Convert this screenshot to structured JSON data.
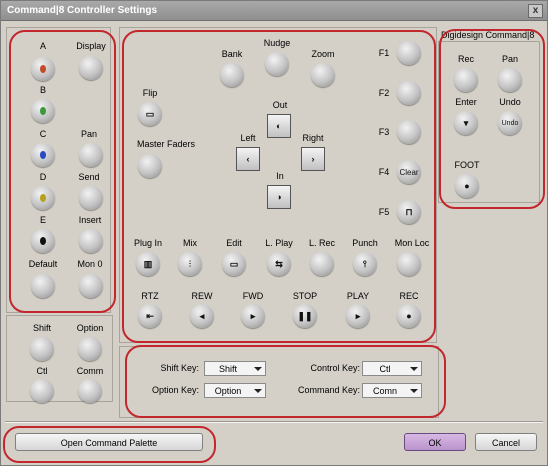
{
  "window": {
    "title": "Command|8 Controller Settings",
    "close_label": "x"
  },
  "left_panel": {
    "col_headers": [
      "A",
      "Display"
    ],
    "rows": [
      {
        "left": "B",
        "right": ""
      },
      {
        "left": "C",
        "right": "Pan"
      },
      {
        "left": "D",
        "right": "Send"
      },
      {
        "left": "E",
        "right": "Insert"
      },
      {
        "left": "Default",
        "right": "Mon 0"
      }
    ],
    "colors": {
      "A": "#c44a2a",
      "B": "#3a9a3a",
      "C": "#2a4ac4",
      "D": "#b8a020",
      "E": "#111111"
    }
  },
  "modifier_panel": {
    "shift": "Shift",
    "option": "Option",
    "ctl": "Ctl",
    "comm": "Comm"
  },
  "center_panel": {
    "bank": "Bank",
    "nudge": "Nudge",
    "zoom": "Zoom",
    "flip": "Flip",
    "master_faders": "Master Faders",
    "out": "Out",
    "in": "In",
    "left": "Left",
    "right": "Right",
    "f_keys": [
      "F1",
      "F2",
      "F3",
      "F4",
      "F5"
    ],
    "f4_button": "Clear",
    "mode_labels": [
      "Plug In",
      "Mix",
      "Edit",
      "L. Play",
      "L. Rec",
      "Punch",
      "Mon Loc"
    ],
    "transport_labels": [
      "RTZ",
      "REW",
      "FWD",
      "STOP",
      "PLAY",
      "REC"
    ]
  },
  "keys_panel": {
    "shift_key_label": "Shift Key:",
    "shift_key_value": "Shift",
    "option_key_label": "Option Key:",
    "option_key_value": "Option",
    "control_key_label": "Control Key:",
    "control_key_value": "Ctl",
    "command_key_label": "Command Key:",
    "command_key_value": "Comn"
  },
  "digidesign_panel": {
    "title": "Digidesign Command|8",
    "rec": "Rec",
    "pan": "Pan",
    "enter": "Enter",
    "undo": "Undo",
    "undo_button": "Undo",
    "foot": "FOOT"
  },
  "footer": {
    "open_palette": "Open Command Palette",
    "ok": "OK",
    "cancel": "Cancel"
  }
}
